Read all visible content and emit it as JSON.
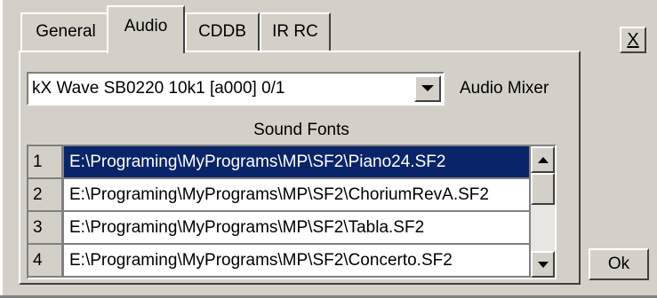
{
  "tabs": [
    {
      "label": "General",
      "active": false
    },
    {
      "label": "Audio",
      "active": true
    },
    {
      "label": "CDDB",
      "active": false
    },
    {
      "label": "IR RC",
      "active": false
    }
  ],
  "device_select": {
    "value": "kX Wave SB0220 10k1 [a000] 0/1"
  },
  "audio_mixer_label": "Audio Mixer",
  "sound_fonts_label": "Sound Fonts",
  "sound_fonts": [
    {
      "num": "1",
      "path": "E:\\Programing\\MyPrograms\\MP\\SF2\\Piano24.SF2",
      "selected": true
    },
    {
      "num": "2",
      "path": "E:\\Programing\\MyPrograms\\MP\\SF2\\ChoriumRevA.SF2",
      "selected": false
    },
    {
      "num": "3",
      "path": "E:\\Programing\\MyPrograms\\MP\\SF2\\Tabla.SF2",
      "selected": false
    },
    {
      "num": "4",
      "path": "E:\\Programing\\MyPrograms\\MP\\SF2\\Concerto.SF2",
      "selected": false
    }
  ],
  "close_button": {
    "label": "X"
  },
  "ok_button": {
    "label": "Ok"
  },
  "colors": {
    "face": "#d4d0c8",
    "selection": "#0a246a",
    "selection_text": "#ffffff"
  }
}
